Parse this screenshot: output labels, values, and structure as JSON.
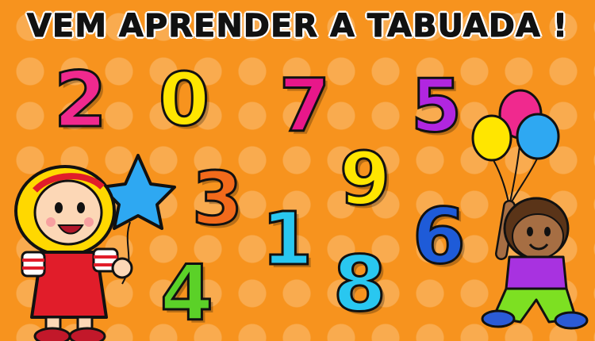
{
  "title": "VEM APRENDER A TABUADA !",
  "digits": [
    {
      "value": "2",
      "color": "#F0298E"
    },
    {
      "value": "0",
      "color": "#FFE600"
    },
    {
      "value": "7",
      "color": "#E8178A"
    },
    {
      "value": "5",
      "color": "#B126E0"
    },
    {
      "value": "3",
      "color": "#F26A1B"
    },
    {
      "value": "9",
      "color": "#FFE600"
    },
    {
      "value": "1",
      "color": "#29C7F0"
    },
    {
      "value": "6",
      "color": "#1E5BD8"
    },
    {
      "value": "4",
      "color": "#5BD128"
    },
    {
      "value": "8",
      "color": "#29C7F0"
    }
  ],
  "illustrations": {
    "girl": {
      "icon": "girl-with-star-balloon",
      "balloon_color": "#2EA8F2"
    },
    "boy": {
      "icon": "boy-with-balloons",
      "balloon_colors": [
        "#F0298E",
        "#FFE600",
        "#2EA8F2"
      ]
    }
  },
  "colors": {
    "background": "#F7931E",
    "polka_dot": "#F9B15E"
  }
}
